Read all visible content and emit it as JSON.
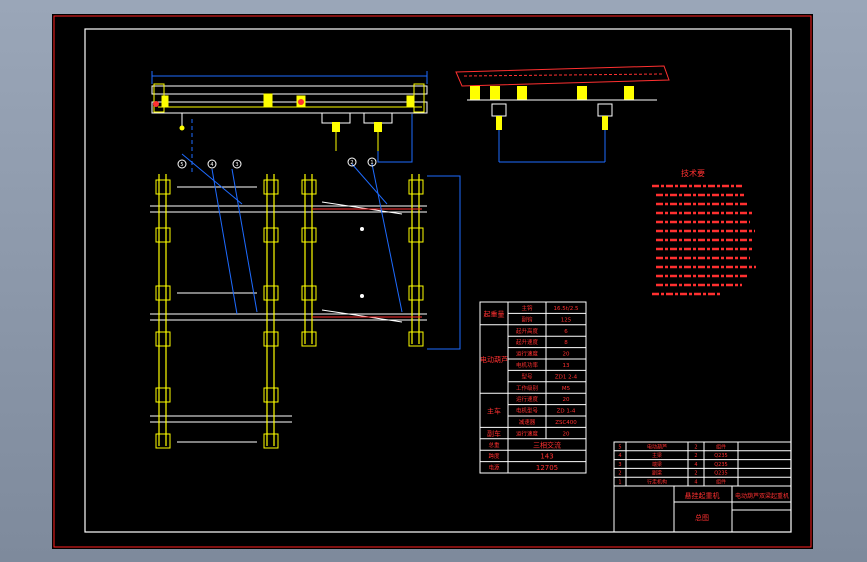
{
  "drawing": {
    "tech_req_title": "技术要",
    "spec_table": {
      "rows": [
        {
          "group": "起重量",
          "param": "主钩",
          "value": "16.5t/2.5"
        },
        {
          "group": "起重量",
          "param": "副钩",
          "value": "125"
        },
        {
          "group": "电动葫芦",
          "param": "起升高度",
          "value": "6"
        },
        {
          "group": "电动葫芦",
          "param": "起升速度",
          "value": "8"
        },
        {
          "group": "电动葫芦",
          "param": "运行速度",
          "value": "20"
        },
        {
          "group": "电动葫芦",
          "param": "电机功率",
          "value": "13"
        },
        {
          "group": "电动葫芦",
          "param": "型号",
          "value": "ZD1 2-4"
        },
        {
          "group": "电动葫芦",
          "param": "工作级别",
          "value": "M5"
        },
        {
          "group": "主车",
          "param": "运行速度",
          "value": "20"
        },
        {
          "group": "主车",
          "param": "电机型号",
          "value": "ZD 1-4"
        },
        {
          "group": "主车",
          "param": "减速器",
          "value": "ZSC400"
        },
        {
          "group": "副车",
          "param": "运行速度",
          "value": "20"
        }
      ],
      "group_labels": [
        "起重量",
        "电动葫芦",
        "主车",
        "副车"
      ],
      "footer": [
        {
          "label": "总重",
          "value": "三相交流"
        },
        {
          "label": "跨度",
          "value": "143"
        },
        {
          "label": "电源",
          "value": "12705"
        }
      ]
    },
    "title_block": {
      "project": "悬挂起重机",
      "drawing_name": "电动葫芦双梁起重机",
      "sheet": "总图",
      "bom_rows": [
        {
          "no": "5",
          "name": "电动葫芦",
          "qty": "2",
          "material": "组件"
        },
        {
          "no": "4",
          "name": "主梁",
          "qty": "2",
          "material": "Q235"
        },
        {
          "no": "3",
          "name": "端梁",
          "qty": "4",
          "material": "Q235"
        },
        {
          "no": "2",
          "name": "副梁",
          "qty": "2",
          "material": "Q235"
        },
        {
          "no": "1",
          "name": "行走机构",
          "qty": "4",
          "material": "组件"
        }
      ]
    },
    "balloons": [
      "5",
      "4",
      "3",
      "2",
      "1"
    ],
    "colors": {
      "background": "#000000",
      "frame": "#ff2020",
      "geometry": "#ffffff",
      "component": "#ffff00",
      "dimension": "#1e6bff",
      "annotation": "#ff3030"
    }
  }
}
